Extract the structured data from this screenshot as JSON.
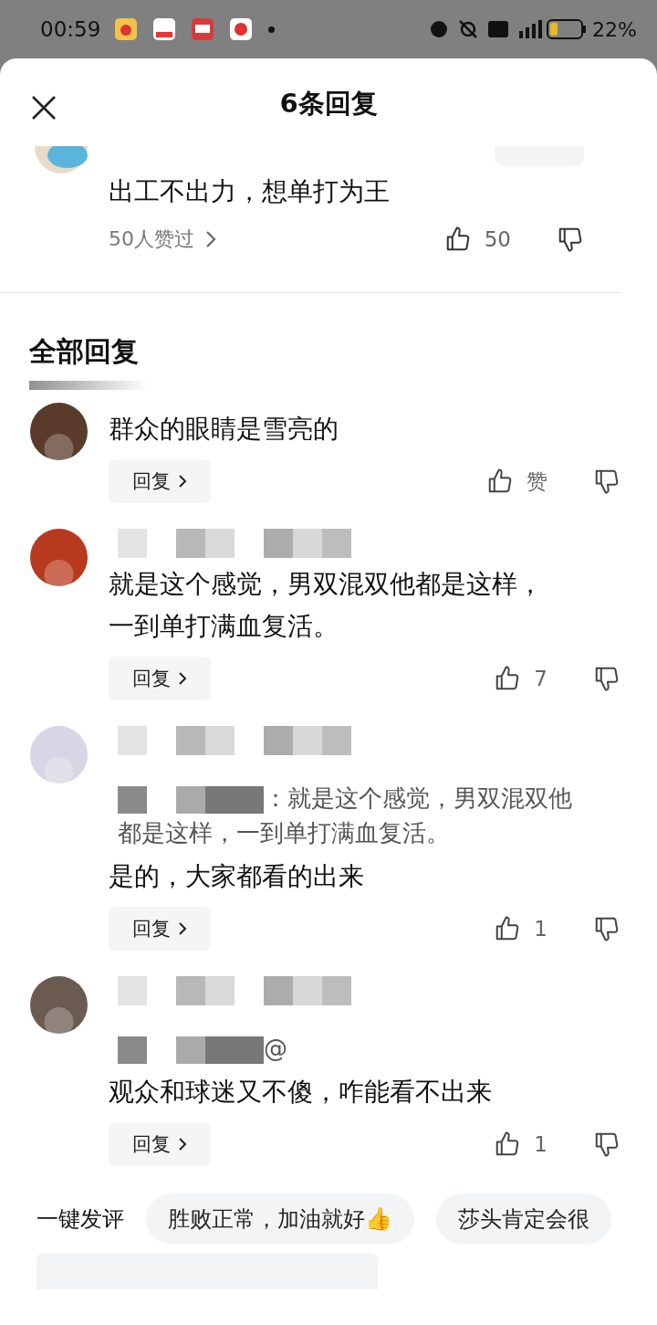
{
  "status_bar": {
    "time": "00:59",
    "battery": "22%"
  },
  "header": {
    "title": "6条回复"
  },
  "main_comment": {
    "text": "出工不出力，想单打为王",
    "likers": "50人赞过",
    "likes": "50"
  },
  "section": {
    "title": "全部回复"
  },
  "replies": [
    {
      "text": "群众的眼睛是雪亮的",
      "reply": "回复",
      "likes": "赞"
    },
    {
      "text": "就是这个感觉，男双混双他都是这样，一到单打满血复活。",
      "reply": "回复",
      "likes": "7"
    },
    {
      "quote": "：就是这个感觉，男双混双他都是这样，一到单打满血复活。",
      "text": "是的，大家都看的出来",
      "reply": "回复",
      "likes": "1"
    },
    {
      "quote": "@",
      "text": "观众和球迷又不傻，咋能看不出来",
      "reply": "回复",
      "likes": "1"
    }
  ],
  "quick": {
    "label": "一键发评",
    "chips": [
      "胜败正常，加油就好👍",
      "莎头肯定会很"
    ]
  }
}
